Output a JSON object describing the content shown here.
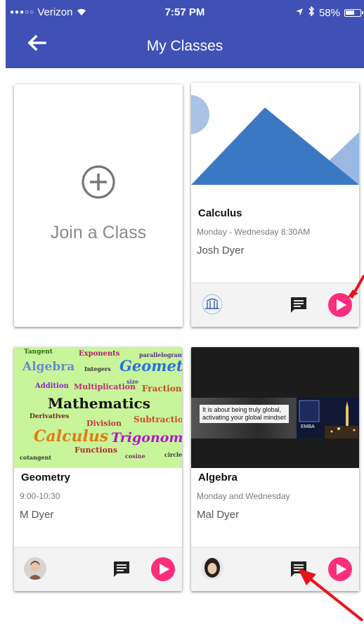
{
  "status_bar": {
    "carrier": "Verizon",
    "time": "7:57 PM",
    "battery": "58%"
  },
  "header": {
    "title": "My Classes"
  },
  "join_card": {
    "label": "Join a Class"
  },
  "classes": [
    {
      "name": "Calculus",
      "schedule": "Monday - Wednesday 8:30AM",
      "teacher": "Josh Dyer"
    },
    {
      "name": "Geometry",
      "schedule": "9:00-10:30",
      "teacher": "M Dyer"
    },
    {
      "name": "Algebra",
      "schedule": "Monday and Wednesday",
      "teacher": "Mal Dyer"
    }
  ],
  "geometry_image_words": {
    "w0": "Tangent",
    "w1": "Exponents",
    "w2": "parallelogram",
    "w3": "Algebra",
    "w4": "Integers",
    "w5": "Geometry",
    "w6": "Addition",
    "w7": "Multiplication",
    "w8": "Fractions",
    "w9": "Mathematics",
    "w10": "Derivatives",
    "w11": "Division",
    "w12": "Subtraction",
    "w13": "Calculus",
    "w14": "Trigonometry",
    "w15": "Functions",
    "w16": "cosine",
    "w17": "cotangent",
    "w18": "size",
    "w19": "circle"
  },
  "algebra_image_text": {
    "line1": "It is about being truly global,",
    "line2": "activating your global mindset",
    "badge": "EMBA"
  },
  "colors": {
    "appbar": "#3f51b5",
    "play": "#ff2d7e",
    "annotation_arrow": "#e8141c"
  }
}
